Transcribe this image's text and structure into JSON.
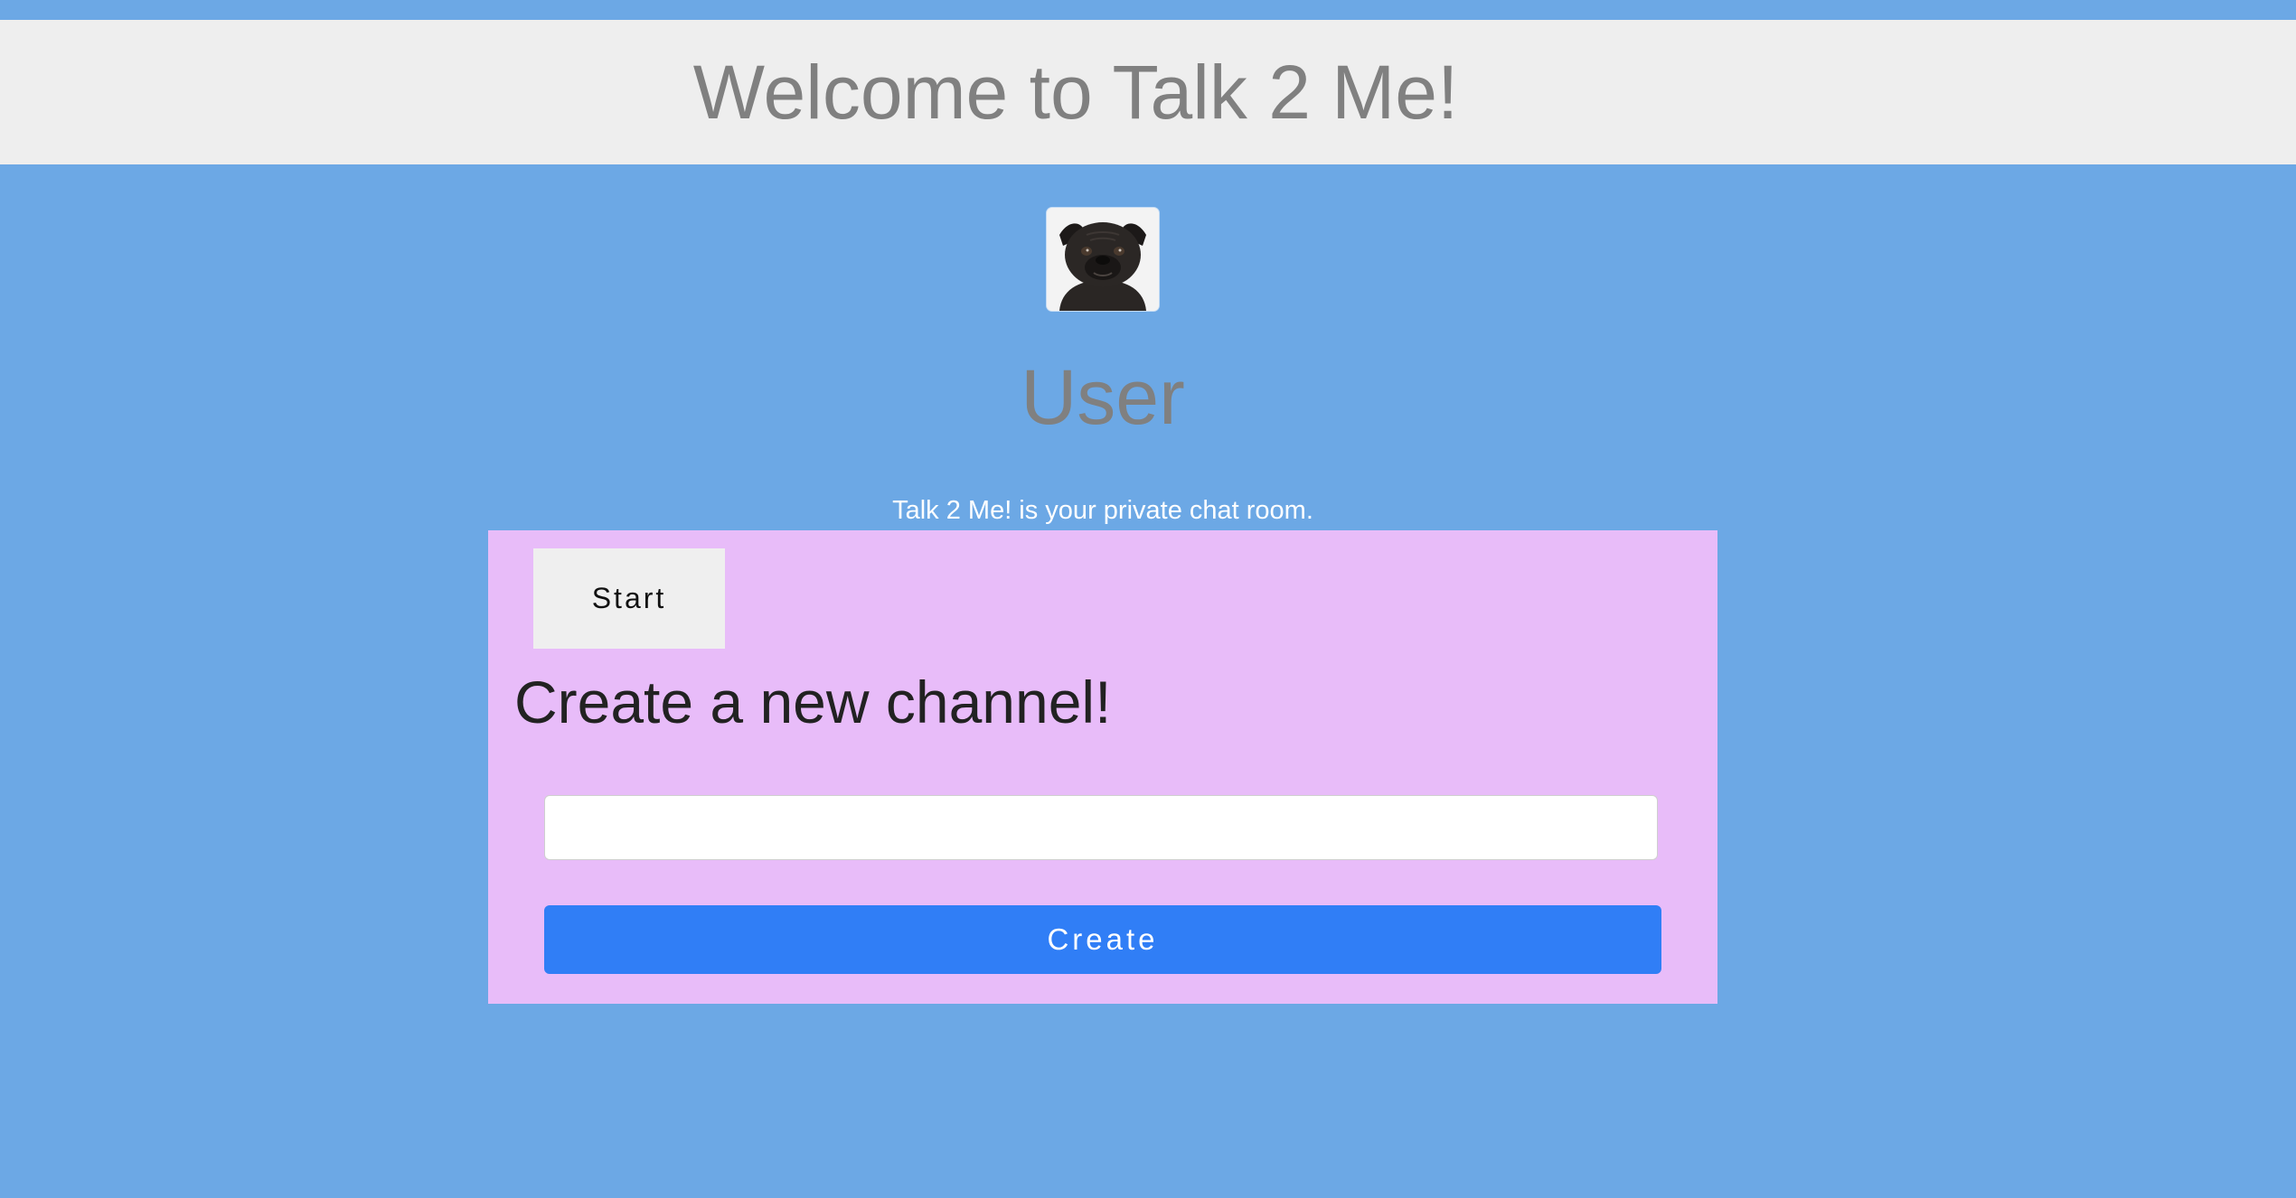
{
  "header": {
    "title": "Welcome to Talk 2 Me!"
  },
  "profile": {
    "avatar_icon": "pug-dog-avatar",
    "user_name": "User",
    "tagline": "Talk 2 Me! is your private chat room."
  },
  "panel": {
    "start_label": "Start",
    "heading": "Create a new channel!",
    "channel_input_value": "",
    "channel_input_placeholder": "",
    "create_label": "Create"
  },
  "colors": {
    "page_background": "#6ca8e5",
    "header_background": "#eeeeee",
    "panel_background": "#e8bcf9",
    "create_button": "#307ef6",
    "start_button": "#efefef"
  }
}
